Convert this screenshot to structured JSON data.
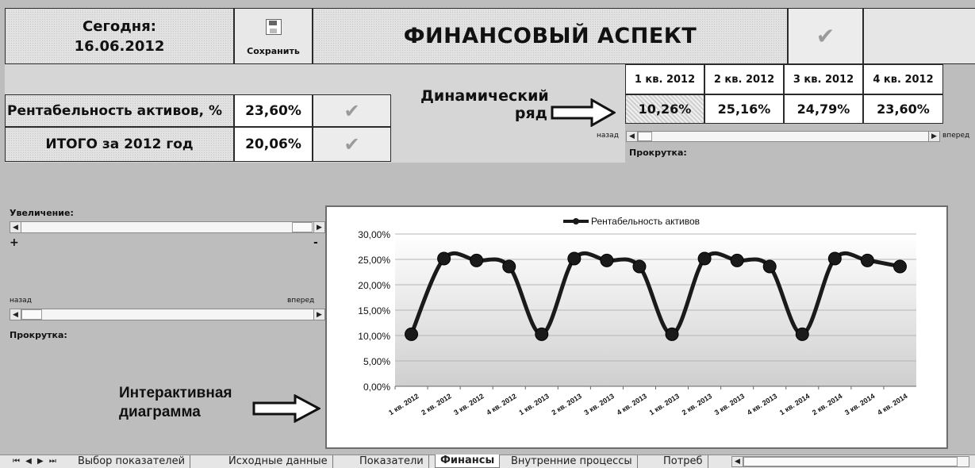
{
  "header": {
    "today_label": "Сегодня:",
    "today_date": "16.06.2012",
    "save_label": "Сохранить",
    "title": "ФИНАНСОВЫЙ АСПЕКТ"
  },
  "metrics": {
    "name": "Рентабельность активов, %",
    "value": "23,60%",
    "total_name": "ИТОГО за 2012 год",
    "total_value": "20,06%"
  },
  "dynamic_row": {
    "label_line1": "Динамический",
    "label_line2": "ряд",
    "headers": [
      "1 кв. 2012",
      "2 кв. 2012",
      "3 кв. 2012",
      "4 кв. 2012"
    ],
    "values": [
      "10,26%",
      "25,16%",
      "24,79%",
      "23,60%"
    ],
    "back_label": "назад",
    "forward_label": "вперед",
    "scroll_label": "Прокрутка:"
  },
  "left_controls": {
    "zoom_label": "Увеличение:",
    "plus": "+",
    "minus": "-",
    "back_label": "назад",
    "forward_label": "вперед",
    "scroll_label": "Прокрутка:"
  },
  "annotation": {
    "interactive_line1": "Интерактивная",
    "interactive_line2": "диаграмма"
  },
  "tabs": {
    "nav": "⏮ ◀ ▶ ⏭",
    "items": [
      "Выбор показателей",
      "Исходные данные",
      "Показатели",
      "Финансы",
      "Внутренние процессы",
      "Потреб"
    ],
    "active_index": 3
  },
  "chart_data": {
    "type": "line",
    "legend": "Рентабельность активов",
    "categories": [
      "1 кв. 2012",
      "2 кв. 2012",
      "3 кв. 2012",
      "4 кв. 2012",
      "1 кв. 2013",
      "2 кв. 2013",
      "3 кв. 2013",
      "4 кв. 2013",
      "1 кв. 2013",
      "2 кв. 2013",
      "3 кв. 2013",
      "4 кв. 2013",
      "1 кв. 2014",
      "2 кв. 2014",
      "3 кв. 2014",
      "4 кв. 2014"
    ],
    "values": [
      10.26,
      25.16,
      24.79,
      23.6,
      10.26,
      25.16,
      24.79,
      23.6,
      10.26,
      25.16,
      24.79,
      23.6,
      10.26,
      25.16,
      24.79,
      23.6
    ],
    "yticks": [
      "0,00%",
      "5,00%",
      "10,00%",
      "15,00%",
      "20,00%",
      "25,00%",
      "30,00%"
    ],
    "ylim": [
      0,
      30
    ],
    "grid": true,
    "legend_position": "top"
  }
}
